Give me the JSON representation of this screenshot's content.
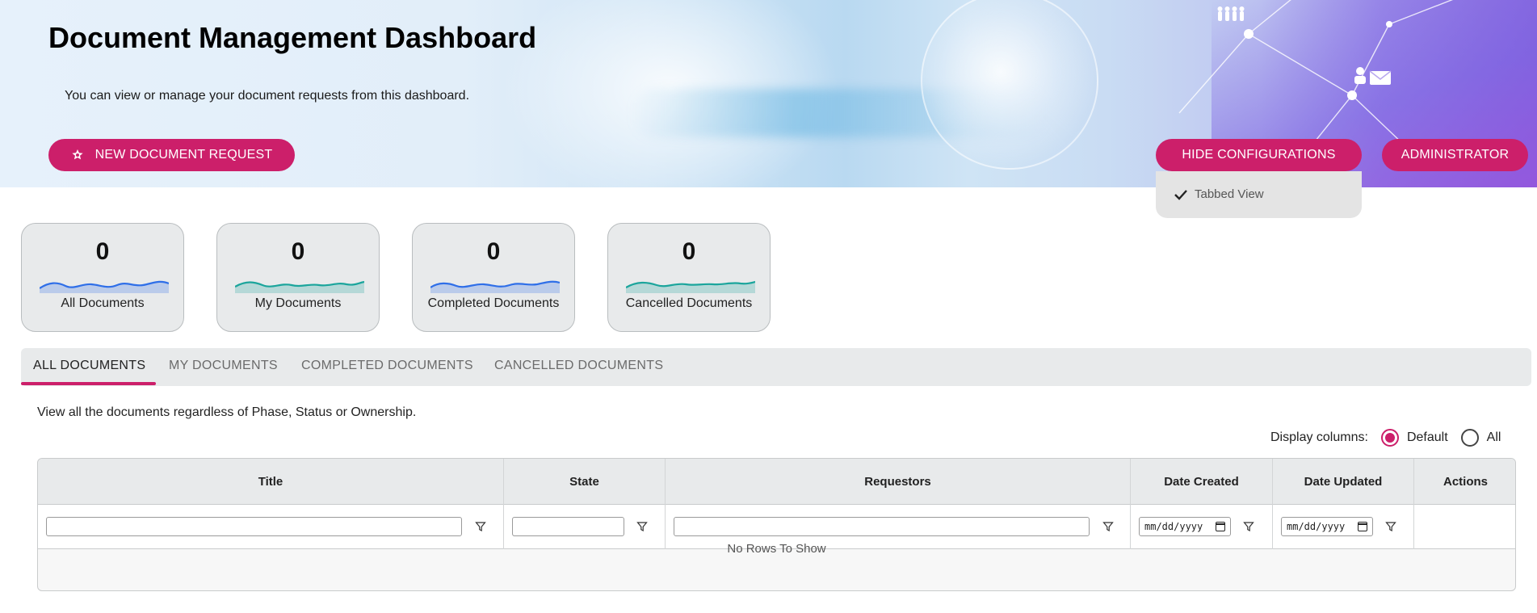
{
  "header": {
    "title": "Document Management Dashboard",
    "subtitle": "You can view or manage your document requests from this dashboard.",
    "new_request_label": "NEW DOCUMENT REQUEST",
    "hide_config_label": "HIDE CONFIGURATIONS",
    "admin_label": "ADMINISTRATOR",
    "accent_color": "#cc1f6a"
  },
  "config_menu": {
    "items": [
      {
        "label": "Tabbed View",
        "checked": true
      }
    ]
  },
  "stats": [
    {
      "count": "0",
      "label": "All Documents",
      "wave_color": "#2f6fe8"
    },
    {
      "count": "0",
      "label": "My Documents",
      "wave_color": "#1ba59c"
    },
    {
      "count": "0",
      "label": "Completed Documents",
      "wave_color": "#2f6fe8"
    },
    {
      "count": "0",
      "label": "Cancelled Documents",
      "wave_color": "#1ba59c"
    }
  ],
  "tabs": [
    {
      "label": "ALL DOCUMENTS",
      "active": true
    },
    {
      "label": "MY DOCUMENTS",
      "active": false
    },
    {
      "label": "COMPLETED DOCUMENTS",
      "active": false
    },
    {
      "label": "CANCELLED DOCUMENTS",
      "active": false
    }
  ],
  "description": "View all the documents regardless of Phase, Status or Ownership.",
  "display_columns": {
    "label": "Display columns:",
    "options": [
      {
        "label": "Default",
        "selected": true
      },
      {
        "label": "All",
        "selected": false
      }
    ]
  },
  "grid": {
    "columns": [
      "Title",
      "State",
      "Requestors",
      "Date Created",
      "Date Updated",
      "Actions"
    ],
    "date_placeholder": "mm/dd/yyyy",
    "empty_message": "No Rows To Show"
  }
}
